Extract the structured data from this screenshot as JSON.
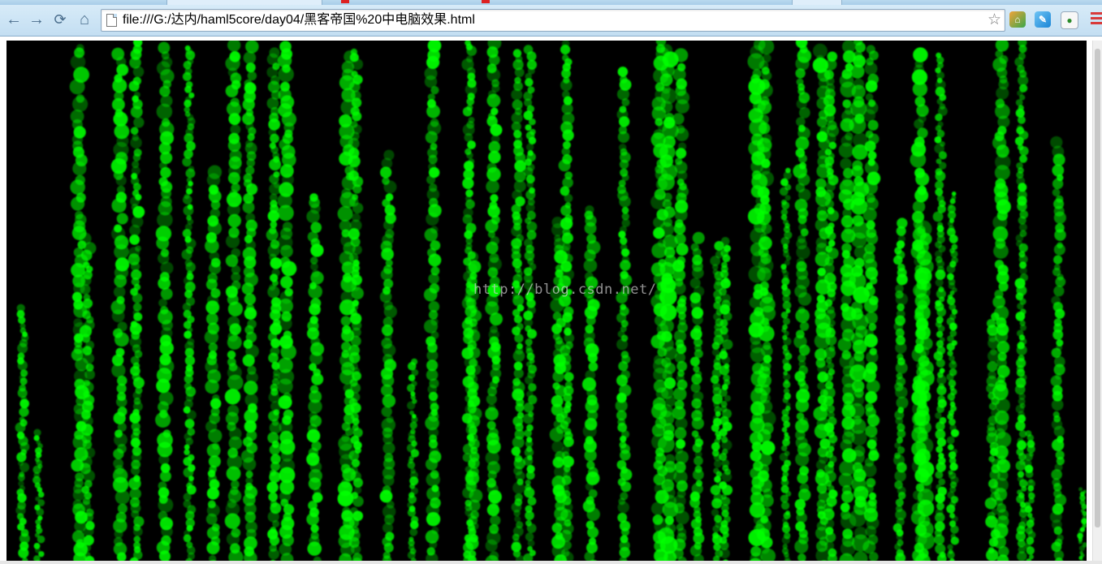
{
  "browser": {
    "url": "file:///G:/达内/haml5core/day04/黑客帝国%20中电脑效果.html",
    "icons": {
      "back": "back-arrow-icon",
      "forward": "forward-arrow-icon",
      "reload": "reload-icon",
      "home": "home-icon",
      "page": "page-icon",
      "bookmark": "star-icon",
      "menu": "menu-icon"
    }
  },
  "page": {
    "watermark": "http://blog.csdn.net/",
    "colors": {
      "background": "#000000",
      "rain": "#00ff00"
    }
  }
}
